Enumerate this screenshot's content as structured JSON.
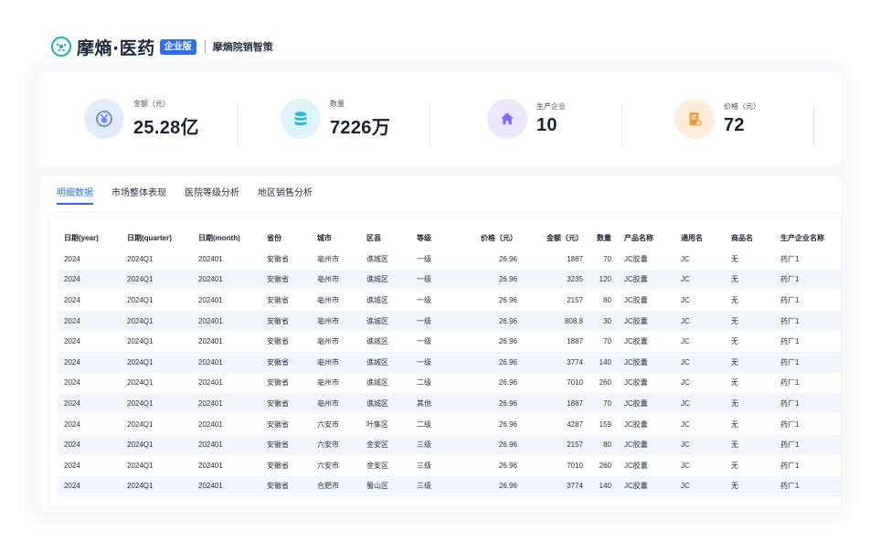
{
  "header": {
    "logo_text": "摩熵·医药",
    "badge": "企业版",
    "subtitle": "摩熵院销智策"
  },
  "stats": [
    {
      "label": "金额（元）",
      "value": "25.28亿",
      "icon": "yen-icon",
      "color": "#4f7df5",
      "bg": "#e3ebfe"
    },
    {
      "label": "数量",
      "value": "7226万",
      "icon": "database-icon",
      "color": "#28b7d6",
      "bg": "#dff4fa"
    },
    {
      "label": "生产企业",
      "value": "10",
      "icon": "home-icon",
      "color": "#8a6bf0",
      "bg": "#ece7fd"
    },
    {
      "label": "价格（元）",
      "value": "72",
      "icon": "document-icon",
      "color": "#f59a3d",
      "bg": "#fdeedc"
    }
  ],
  "tabs": [
    "明细数据",
    "市场整体表现",
    "医院等级分析",
    "地区销售分析"
  ],
  "active_tab": 0,
  "table": {
    "columns": [
      "日期(year)",
      "日期(quarter)",
      "日期(month)",
      "省份",
      "城市",
      "区县",
      "等级",
      "价格（元）",
      "金额（元）",
      "数量",
      "产品名称",
      "通用名",
      "商品名",
      "生产企业名称"
    ],
    "rows": [
      [
        "2024",
        "2024Q1",
        "202401",
        "安徽省",
        "亳州市",
        "谯城区",
        "一级",
        "26.96",
        "1887",
        "70",
        "JC胶囊",
        "JC",
        "无",
        "药厂1"
      ],
      [
        "2024",
        "2024Q1",
        "202401",
        "安徽省",
        "亳州市",
        "谯城区",
        "一级",
        "26.96",
        "3235",
        "120",
        "JC胶囊",
        "JC",
        "无",
        "药厂1"
      ],
      [
        "2024",
        "2024Q1",
        "202401",
        "安徽省",
        "亳州市",
        "谯城区",
        "一级",
        "26.96",
        "2157",
        "80",
        "JC胶囊",
        "JC",
        "无",
        "药厂1"
      ],
      [
        "2024",
        "2024Q1",
        "202401",
        "安徽省",
        "亳州市",
        "谯城区",
        "一级",
        "26.96",
        "808.8",
        "30",
        "JC胶囊",
        "JC",
        "无",
        "药厂1"
      ],
      [
        "2024",
        "2024Q1",
        "202401",
        "安徽省",
        "亳州市",
        "谯城区",
        "一级",
        "26.96",
        "1887",
        "70",
        "JC胶囊",
        "JC",
        "无",
        "药厂1"
      ],
      [
        "2024",
        "2024Q1",
        "202401",
        "安徽省",
        "亳州市",
        "谯城区",
        "一级",
        "26.96",
        "3774",
        "140",
        "JC胶囊",
        "JC",
        "无",
        "药厂1"
      ],
      [
        "2024",
        "2024Q1",
        "202401",
        "安徽省",
        "亳州市",
        "谯城区",
        "二级",
        "26.96",
        "7010",
        "260",
        "JC胶囊",
        "JC",
        "无",
        "药厂1"
      ],
      [
        "2024",
        "2024Q1",
        "202401",
        "安徽省",
        "亳州市",
        "谯城区",
        "其他",
        "26.96",
        "1887",
        "70",
        "JC胶囊",
        "JC",
        "无",
        "药厂1"
      ],
      [
        "2024",
        "2024Q1",
        "202401",
        "安徽省",
        "六安市",
        "叶集区",
        "二级",
        "26.96",
        "4287",
        "159",
        "JC胶囊",
        "JC",
        "无",
        "药厂1"
      ],
      [
        "2024",
        "2024Q1",
        "202401",
        "安徽省",
        "六安市",
        "金安区",
        "三级",
        "26.96",
        "2157",
        "80",
        "JC胶囊",
        "JC",
        "无",
        "药厂1"
      ],
      [
        "2024",
        "2024Q1",
        "202401",
        "安徽省",
        "六安市",
        "金安区",
        "三级",
        "26.96",
        "7010",
        "260",
        "JC胶囊",
        "JC",
        "无",
        "药厂1"
      ],
      [
        "2024",
        "2024Q1",
        "202401",
        "安徽省",
        "合肥市",
        "蜀山区",
        "三级",
        "26.96",
        "3774",
        "140",
        "JC胶囊",
        "JC",
        "无",
        "药厂1"
      ]
    ]
  }
}
